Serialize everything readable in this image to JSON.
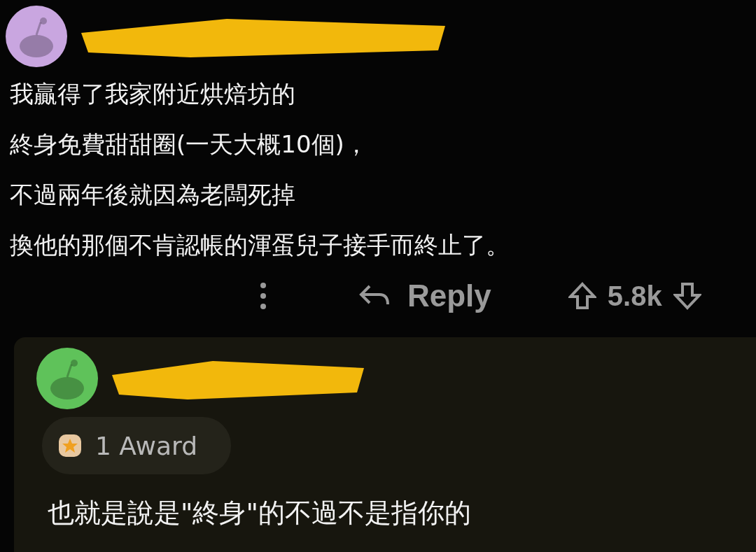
{
  "comment": {
    "lines": [
      "我贏得了我家附近烘焙坊的",
      "終身免費甜甜圈(一天大概10個)，",
      "不過兩年後就因為老闆死掉",
      "換他的那個不肯認帳的渾蛋兒子接手而終止了。"
    ],
    "reply_label": "Reply",
    "score": "5.8k"
  },
  "reply": {
    "award": "1 Award",
    "text": "也就是說是\"終身\"的不過不是指你的"
  }
}
